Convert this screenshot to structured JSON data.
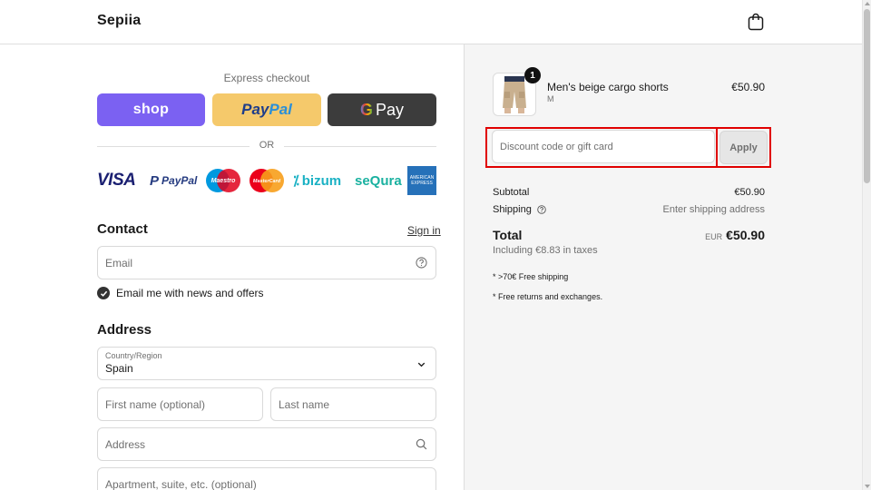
{
  "header": {
    "brand": "Sepiia",
    "cart_icon": "shopping-bag-icon"
  },
  "express": {
    "title": "Express checkout",
    "shop_label": "shop",
    "paypal_label_pay": "Pay",
    "paypal_label_pal": "Pal",
    "gpay_label": "Pay",
    "or_label": "OR"
  },
  "payment_logos": {
    "visa": "VISA",
    "paypal": "PayPal",
    "maestro": "Maestro",
    "mastercard": "MasterCard",
    "bizum": "bizum",
    "sequra": "seQura",
    "amex": "AMERICAN EXPRESS"
  },
  "contact": {
    "title": "Contact",
    "signin": "Sign in",
    "email_placeholder": "Email",
    "newsletter_label": "Email me with news and offers",
    "newsletter_checked": true
  },
  "address": {
    "title": "Address",
    "country_label": "Country/Region",
    "country_value": "Spain",
    "first_name_placeholder": "First name (optional)",
    "last_name_placeholder": "Last name",
    "address_placeholder": "Address",
    "apartment_placeholder": "Apartment, suite, etc. (optional)"
  },
  "order": {
    "product_name": "Men's beige cargo shorts",
    "product_variant": "M",
    "product_price": "€50.90",
    "quantity": "1",
    "discount_placeholder": "Discount code or gift card",
    "apply_label": "Apply",
    "subtotal_label": "Subtotal",
    "subtotal_value": "€50.90",
    "shipping_label": "Shipping",
    "shipping_value": "Enter shipping address",
    "total_label": "Total",
    "total_currency": "EUR",
    "total_value": "€50.90",
    "taxes_note": "Including €8.83 in taxes",
    "note_1": "* >70€ Free shipping",
    "note_2": "* Free returns and exchanges."
  }
}
